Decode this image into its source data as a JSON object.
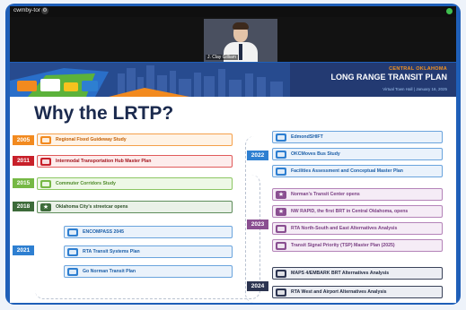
{
  "meeting": {
    "participant_label": "cwmby-tor",
    "participant_badge": "⚙",
    "speaker_name": "J. Clay Gilliam"
  },
  "banner": {
    "org": "CENTRAL OKLAHOMA",
    "title": "LONG RANGE TRANSIT PLAN",
    "subtitle": "Virtual Town Hall | January 16, 2025"
  },
  "slide_title": "Why the LRTP?",
  "timeline_left": {
    "years": [
      "2005",
      "2011",
      "2015",
      "2018",
      "2021"
    ],
    "items": [
      {
        "label": "Regional Fixed Guideway Study",
        "icon": "document-icon"
      },
      {
        "label": "Intermodal Transportation Hub Master Plan",
        "icon": "document-icon"
      },
      {
        "label": "Commuter Corridors Study",
        "icon": "document-icon"
      },
      {
        "label": "Oklahoma City's streetcar opens",
        "icon": "star-icon"
      },
      {
        "label": "ENCOMPASS 2045",
        "icon": "document-icon"
      },
      {
        "label": "RTA Transit Systems Plan",
        "icon": "document-icon"
      },
      {
        "label": "Go Norman Transit Plan",
        "icon": "document-icon"
      }
    ]
  },
  "timeline_right": {
    "years": [
      "2022",
      "2023",
      "2024"
    ],
    "items": [
      {
        "label": "EdmondSHIFT",
        "icon": "document-icon"
      },
      {
        "label": "OKCMoves Bus Study",
        "icon": "document-icon"
      },
      {
        "label": "Facilities Assessment and Conceptual Master Plan",
        "icon": "document-icon"
      },
      {
        "label": "Norman's Transit Center opens",
        "icon": "star-icon"
      },
      {
        "label": "NW RAPID, the first BRT in Central Oklahoma, opens",
        "icon": "star-icon"
      },
      {
        "label": "RTA North-South and East Alternatives Analysis",
        "icon": "document-icon"
      },
      {
        "label": "Transit Signal Priority (TSP) Master Plan (2025)",
        "icon": "document-icon"
      },
      {
        "label": "MAPS 4/EMBARK BRT Alternatives Analysis",
        "icon": "document-icon"
      },
      {
        "label": "RTA West and Airport Alternatives Analysis",
        "icon": "document-icon"
      }
    ]
  },
  "colors": {
    "frame": "#1f5fb8",
    "orange": "#f28a1f",
    "red": "#c8202a",
    "light_green": "#76b845",
    "dark_green": "#3d6b3a",
    "blue": "#2e7fd1",
    "purple": "#8a4f91",
    "navy": "#2c3450"
  }
}
